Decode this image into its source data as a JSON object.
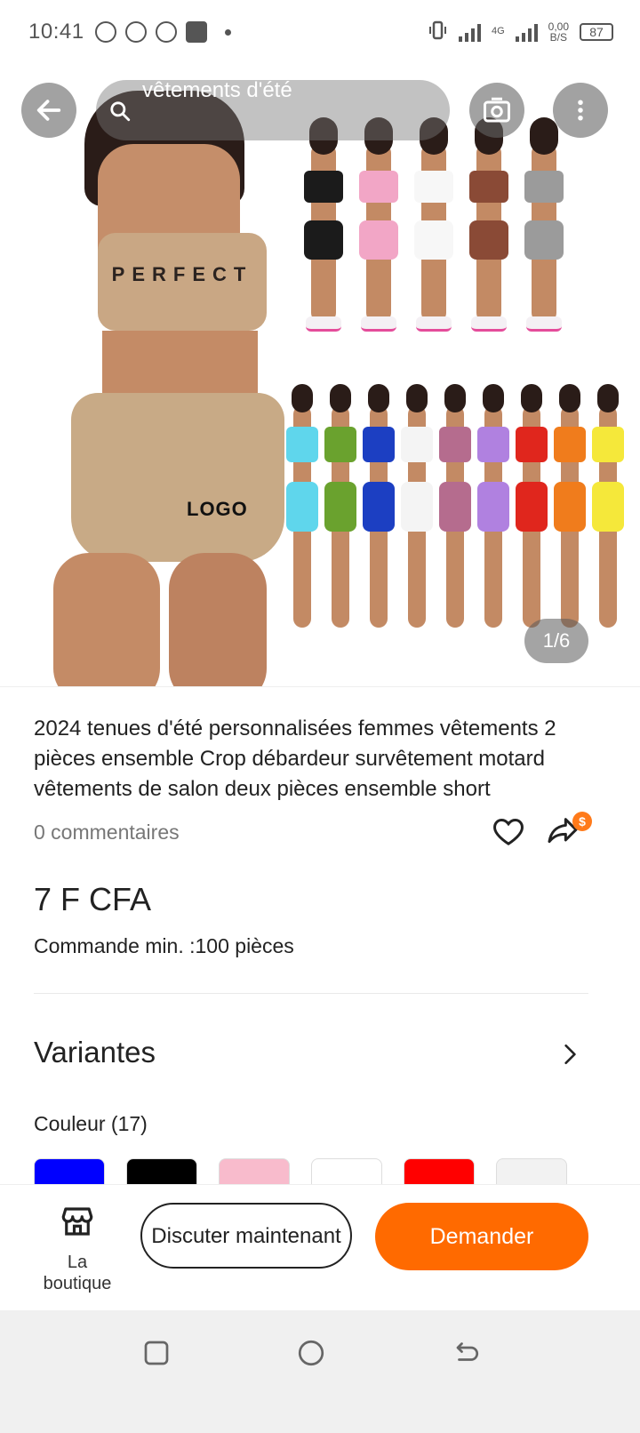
{
  "status_bar": {
    "time": "10:41",
    "network": "4G",
    "speed": "0,00",
    "speed_unit": "B/S",
    "battery": "87"
  },
  "header": {
    "search_text": "vêtements d'été",
    "back_icon": "arrow-left-icon",
    "camera_icon": "camera-icon",
    "more_icon": "more-vertical-icon"
  },
  "gallery": {
    "page_indicator": "1/6",
    "main_top_print": "PERFECT",
    "main_shorts_print": "LOGO",
    "row1_colors": [
      "#1b1b1b",
      "#f2a6c6",
      "#f7f7f7",
      "#8a4a36",
      "#9b9b9b"
    ],
    "row2_colors": [
      "#5fd6ec",
      "#6aa22e",
      "#1c3fc2",
      "#f4f4f4",
      "#b56c8e",
      "#b081e0",
      "#e0261d",
      "#f07c1c",
      "#f5e83a"
    ]
  },
  "product": {
    "title": "2024 tenues d'été personnalisées femmes vêtements 2 pièces ensemble Crop débardeur survêtement motard vêtements de salon deux pièces ensemble short",
    "comments": "0 commentaires",
    "price": "7 F CFA",
    "min_order": "Commande min. :100 pièces",
    "share_badge": "$"
  },
  "variants": {
    "heading": "Variantes",
    "color_label": "Couleur (17)",
    "swatches": [
      "#0000ff",
      "#000000",
      "#f8bbcc",
      "#ffffff",
      "#ff0000",
      "#f2f2f2"
    ]
  },
  "bottom_bar": {
    "shop_label": "La boutique",
    "chat_label": "Discuter maintenant",
    "ask_label": "Demander",
    "accent": "#ff6a00"
  }
}
